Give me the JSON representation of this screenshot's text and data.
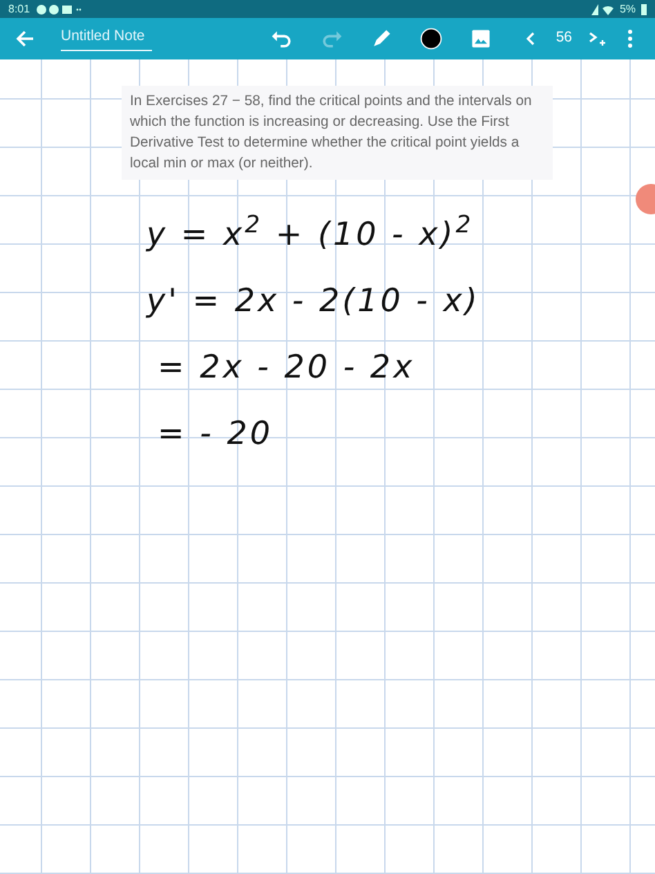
{
  "status_bar": {
    "time": "8:01",
    "battery": "5%"
  },
  "toolbar": {
    "title": "Untitled Note",
    "page": "56",
    "tools": [
      {
        "kind": "undo",
        "disabled": false
      },
      {
        "kind": "redo",
        "disabled": true
      },
      {
        "kind": "pen",
        "disabled": false
      },
      {
        "kind": "color",
        "disabled": false
      },
      {
        "kind": "image",
        "disabled": false
      }
    ]
  },
  "prompt": "In Exercises 27 − 58, find the critical points and the intervals on which the function is increasing or decreasing. Use the First Derivative Test to determine whether the critical point yields a local min or max (or neither).",
  "handwriting": [
    {
      "text": "y = x$^{2}$ + (10 - x)$^{2}$",
      "indent": false
    },
    {
      "text": "y' = 2x -  2(10 - x)",
      "indent": false
    },
    {
      "text": "= 2x - 20 - 2x",
      "indent": true
    },
    {
      "text": "= - 20",
      "indent": true
    }
  ]
}
